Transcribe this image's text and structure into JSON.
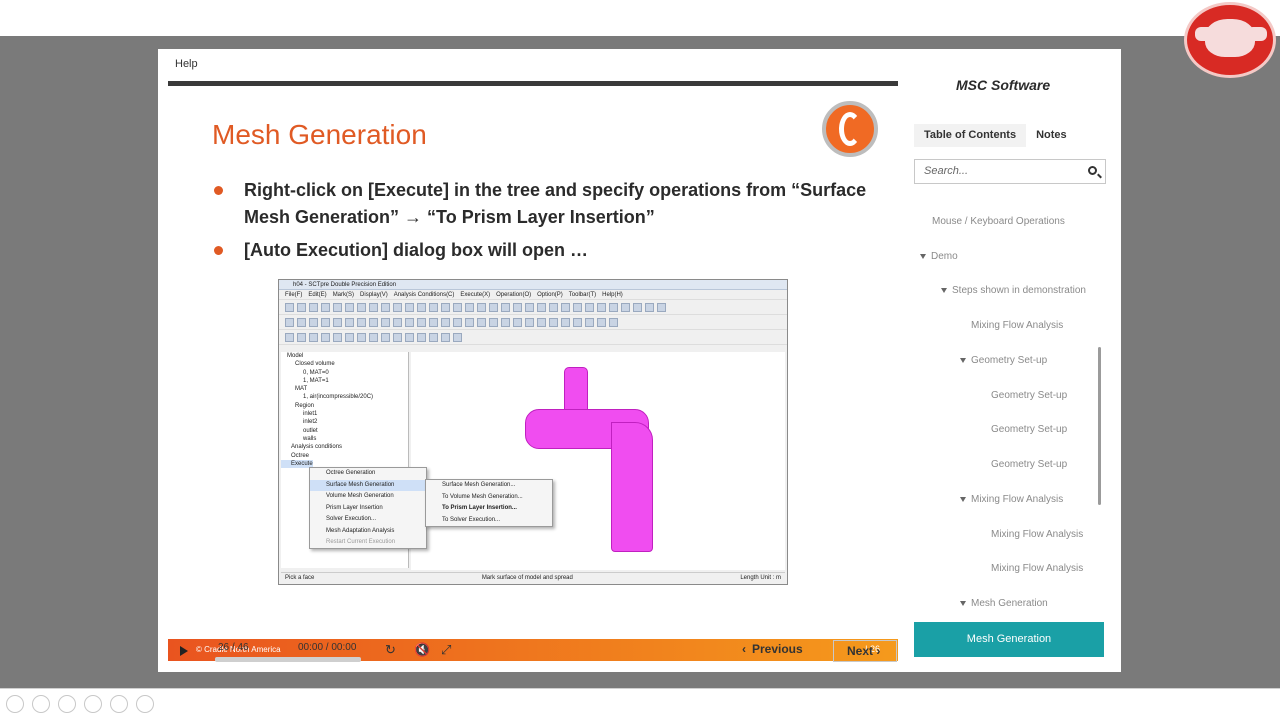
{
  "player": {
    "help_label": "Help",
    "brand_logo": "MSC Software",
    "tabs": [
      {
        "label": "Table of Contents"
      },
      {
        "label": "Notes"
      }
    ],
    "search_placeholder": "Search...",
    "toc": [
      {
        "label": "Mouse / Keyboard Operations",
        "level": 0,
        "expanded": false
      },
      {
        "label": "Demo",
        "level": 0,
        "expanded": true
      },
      {
        "label": "Steps shown in demonstration",
        "level": 1,
        "expanded": true
      },
      {
        "label": "Mixing Flow Analysis",
        "level": 2,
        "expanded": false
      },
      {
        "label": "Geometry Set-up",
        "level": 2,
        "expanded": true
      },
      {
        "label": "Geometry Set-up",
        "level": 3,
        "expanded": false
      },
      {
        "label": "Geometry Set-up",
        "level": 3,
        "expanded": false
      },
      {
        "label": "Geometry Set-up",
        "level": 3,
        "expanded": false
      },
      {
        "label": "Mixing Flow Analysis",
        "level": 2,
        "expanded": true
      },
      {
        "label": "Mixing Flow Analysis",
        "level": 3,
        "expanded": false
      },
      {
        "label": "Mixing Flow Analysis",
        "level": 3,
        "expanded": false
      },
      {
        "label": "Mesh Generation",
        "level": 2,
        "expanded": true
      }
    ],
    "toc_active": "Mesh Generation",
    "accent_color": "#1aa0a6"
  },
  "slide": {
    "title": "Mesh Generation",
    "bullets": [
      "Right-click on [Execute] in the tree and specify operations from “Surface Mesh Generation” → “To Prism Layer Insertion”",
      "[Auto Execution] dialog box will open …"
    ],
    "footer_copyright": "© Cradle North America",
    "footer_page": "| 26",
    "title_color": "#e05a24"
  },
  "screenshot": {
    "window_title": "h04 - SCTpre Double Precision Edition",
    "menu": [
      "File(F)",
      "Edit(E)",
      "Mark(S)",
      "Display(V)",
      "Analysis Conditions(C)",
      "Execute(X)",
      "Operation(O)",
      "Option(P)",
      "Toolbar(T)",
      "Help(H)"
    ],
    "tree": [
      "Model",
      "Closed volume",
      "0, MAT=0",
      "1, MAT=1",
      "MAT",
      "1, air(incompressible/20C)",
      "Region",
      "inlet1",
      "inlet2",
      "outlet",
      "walls",
      "Analysis conditions",
      "Octree",
      "Execute"
    ],
    "context_menu": [
      "Octree Generation",
      "Surface Mesh Generation",
      "Volume Mesh Generation",
      "Prism Layer Insertion",
      "Solver Execution...",
      "Mesh Adaptation Analysis",
      "Restart Current Execution"
    ],
    "submenu": [
      "Surface Mesh Generation...",
      "To Volume Mesh Generation...",
      "To Prism Layer Insertion...",
      "To Solver Execution..."
    ],
    "status_left": "Pick a face",
    "status_mid": "Mark surface of model and spread",
    "status_right": "Length Unit : m"
  },
  "controls": {
    "slide_counter": "26 / 46",
    "time": "00:00 / 00:00",
    "progress": 0,
    "prev_label": "Previous",
    "next_label": "Next"
  }
}
